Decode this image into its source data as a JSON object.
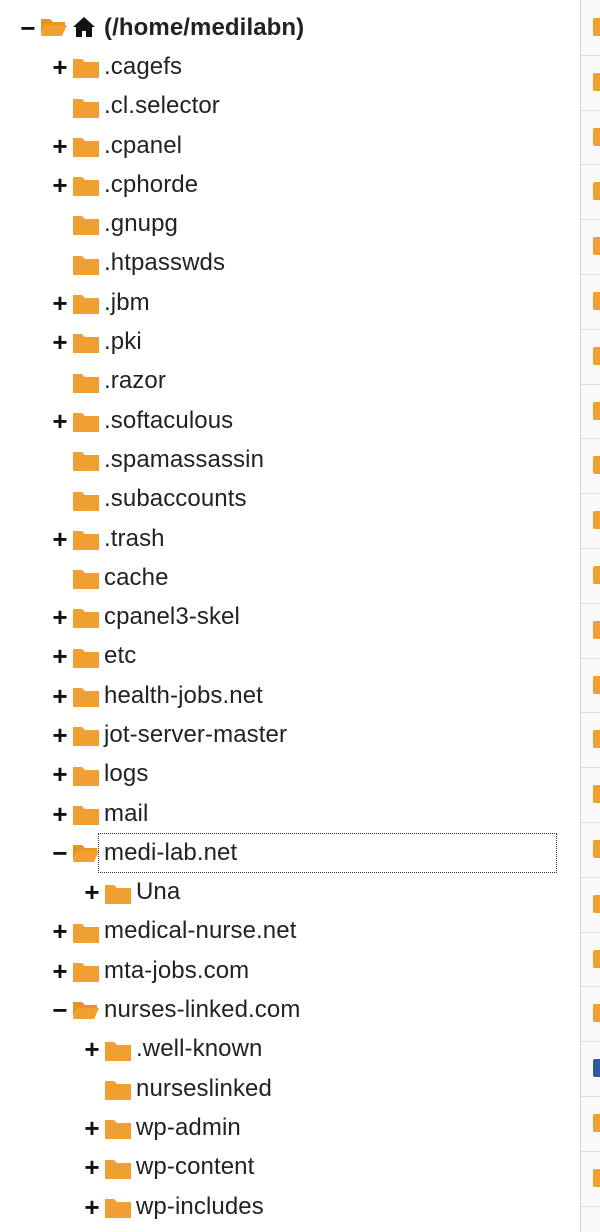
{
  "colors": {
    "folder": "#f0a030",
    "folder_dark": "#e59520",
    "text": "#222222"
  },
  "tree": {
    "root": {
      "label": "(/home/medilabn)",
      "expanded": true,
      "icon": "home-icon"
    },
    "items": [
      {
        "label": ".cagefs",
        "depth": 1,
        "toggle": "+"
      },
      {
        "label": ".cl.selector",
        "depth": 1,
        "toggle": ""
      },
      {
        "label": ".cpanel",
        "depth": 1,
        "toggle": "+"
      },
      {
        "label": ".cphorde",
        "depth": 1,
        "toggle": "+"
      },
      {
        "label": ".gnupg",
        "depth": 1,
        "toggle": ""
      },
      {
        "label": ".htpasswds",
        "depth": 1,
        "toggle": ""
      },
      {
        "label": ".jbm",
        "depth": 1,
        "toggle": "+"
      },
      {
        "label": ".pki",
        "depth": 1,
        "toggle": "+"
      },
      {
        "label": ".razor",
        "depth": 1,
        "toggle": ""
      },
      {
        "label": ".softaculous",
        "depth": 1,
        "toggle": "+"
      },
      {
        "label": ".spamassassin",
        "depth": 1,
        "toggle": ""
      },
      {
        "label": ".subaccounts",
        "depth": 1,
        "toggle": ""
      },
      {
        "label": ".trash",
        "depth": 1,
        "toggle": "+"
      },
      {
        "label": "cache",
        "depth": 1,
        "toggle": ""
      },
      {
        "label": "cpanel3-skel",
        "depth": 1,
        "toggle": "+"
      },
      {
        "label": "etc",
        "depth": 1,
        "toggle": "+"
      },
      {
        "label": "health-jobs.net",
        "depth": 1,
        "toggle": "+"
      },
      {
        "label": "jot-server-master",
        "depth": 1,
        "toggle": "+"
      },
      {
        "label": "logs",
        "depth": 1,
        "toggle": "+"
      },
      {
        "label": "mail",
        "depth": 1,
        "toggle": "+"
      },
      {
        "label": "medi-lab.net",
        "depth": 1,
        "toggle": "−",
        "open": true,
        "selected": true
      },
      {
        "label": "Una",
        "depth": 2,
        "toggle": "+"
      },
      {
        "label": "medical-nurse.net",
        "depth": 1,
        "toggle": "+"
      },
      {
        "label": "mta-jobs.com",
        "depth": 1,
        "toggle": "+"
      },
      {
        "label": "nurses-linked.com",
        "depth": 1,
        "toggle": "−",
        "open": true
      },
      {
        "label": ".well-known",
        "depth": 2,
        "toggle": "+"
      },
      {
        "label": "nurseslinked",
        "depth": 2,
        "toggle": ""
      },
      {
        "label": "wp-admin",
        "depth": 2,
        "toggle": "+"
      },
      {
        "label": "wp-content",
        "depth": 2,
        "toggle": "+"
      },
      {
        "label": "wp-includes",
        "depth": 2,
        "toggle": "+"
      }
    ]
  },
  "right_column": {
    "rows": [
      "orange",
      "orange",
      "orange",
      "orange",
      "orange",
      "orange",
      "orange",
      "orange",
      "orange",
      "orange",
      "orange",
      "orange",
      "orange",
      "orange",
      "orange",
      "orange",
      "orange",
      "orange",
      "orange",
      "blue",
      "orange",
      "orange"
    ]
  }
}
